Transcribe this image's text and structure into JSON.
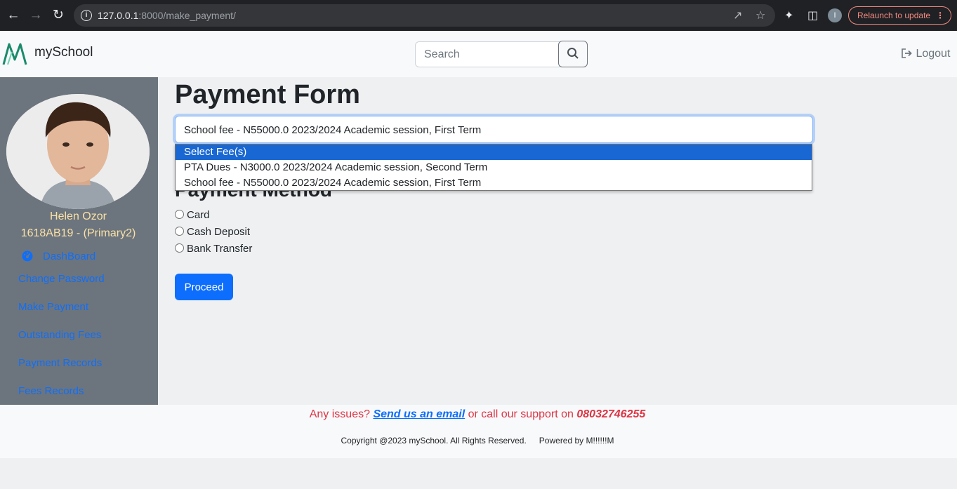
{
  "browser": {
    "url_host": "127.0.0.1",
    "url_rest": ":8000/make_payment/",
    "relaunch_label": "Relaunch to update",
    "profile_initial": "I"
  },
  "header": {
    "brand": "mySchool",
    "search_placeholder": "Search",
    "logout_label": "Logout"
  },
  "sidebar": {
    "student_name": "Helen Ozor",
    "student_id": "1618AB19 - (Primary2)",
    "links": [
      "DashBoard",
      "Change Password",
      "Make Payment",
      "Outstanding Fees",
      "Payment Records",
      "Fees Records"
    ]
  },
  "main": {
    "title": "Payment Form",
    "fee_selected": "School fee - N55000.0 2023/2024 Academic session, First Term",
    "fee_options": [
      "Select Fee(s)",
      "PTA Dues - N3000.0 2023/2024 Academic session, Second Term",
      "School fee - N55000.0 2023/2024 Academic session, First Term"
    ],
    "highlighted_option": 0,
    "method_title": "Payment Method",
    "methods": [
      "Card",
      "Cash Deposit",
      "Bank Transfer"
    ],
    "proceed_label": "Proceed"
  },
  "footer": {
    "issues_prefix": "Any issues?",
    "email_link": "Send us an email",
    "issues_middle": "or call our support on",
    "phone": "08032746255",
    "copyright": "Copyright @2023 mySchool. All Rights Reserved.",
    "powered_by": "Powered by M!!!!!!M"
  },
  "colors": {
    "primary": "#0d6efd",
    "sidebar_bg": "#6c757d",
    "name_text": "#fbe0a6",
    "danger": "#dc3545",
    "option_highlight": "#1967d2"
  }
}
